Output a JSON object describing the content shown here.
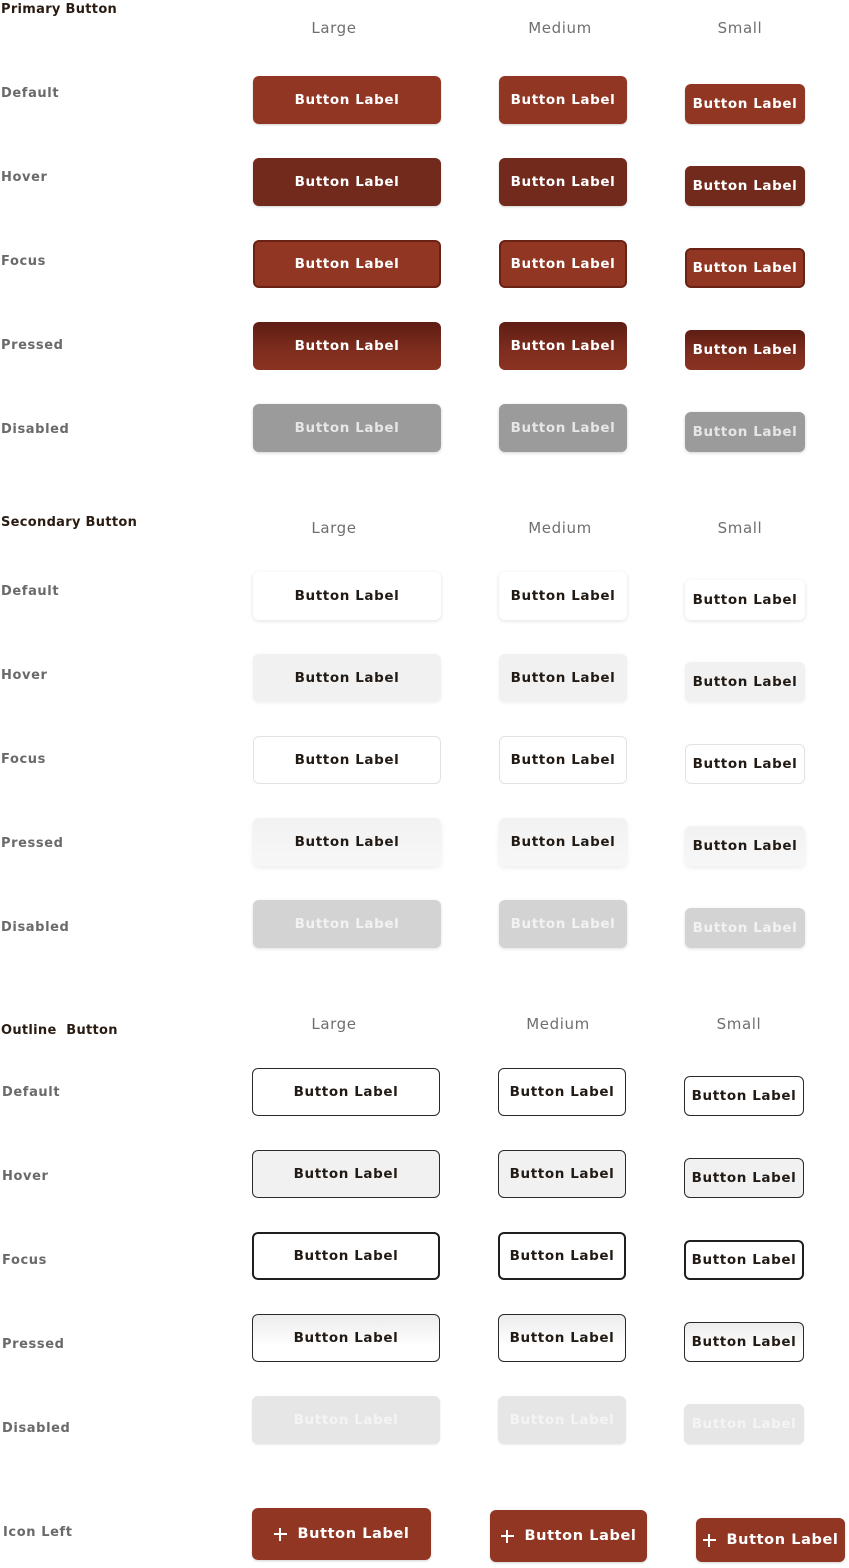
{
  "sections": {
    "primary": "Primary Button",
    "secondary": "Secondary Button",
    "outline": "Outline  Button",
    "icon_left": "Icon Left"
  },
  "sizes": {
    "large": "Large",
    "medium": "Medium",
    "small": "Small"
  },
  "states": {
    "default": "Default",
    "hover": "Hover",
    "focus": "Focus",
    "pressed": "Pressed",
    "disabled": "Disabled"
  },
  "button_label": "Button Label",
  "icons": {
    "icon_left": "plus-icon"
  },
  "colors": {
    "primary": "#923624",
    "primary_hover": "#722a1d",
    "primary_pressed": "#5e1d13",
    "disabled": "#9b9b9b",
    "secondary_hover": "#f1f1f1",
    "secondary_disabled": "#d3d3d3",
    "outline_border": "#2a2a2a"
  }
}
